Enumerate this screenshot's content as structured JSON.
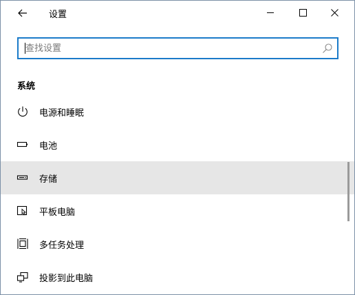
{
  "window": {
    "title": "设置",
    "icons": {
      "back": "arrow-left-icon",
      "minimize": "minimize-icon",
      "maximize": "maximize-icon",
      "close": "close-icon"
    }
  },
  "search": {
    "placeholder": "查找设置",
    "value": "",
    "icon": "search-icon"
  },
  "section": {
    "heading": "系统"
  },
  "nav": {
    "items": [
      {
        "label": "电源和睡眠",
        "icon": "power-icon"
      },
      {
        "label": "电池",
        "icon": "battery-icon"
      },
      {
        "label": "存储",
        "icon": "storage-icon",
        "selected": true
      },
      {
        "label": "平板电脑",
        "icon": "tablet-icon"
      },
      {
        "label": "多任务处理",
        "icon": "multitasking-icon"
      },
      {
        "label": "投影到此电脑",
        "icon": "project-icon"
      }
    ]
  },
  "colors": {
    "accent": "#1a7ac9",
    "selected_row": "#e6e6e6",
    "scrollbar": "#9a9a9a"
  }
}
